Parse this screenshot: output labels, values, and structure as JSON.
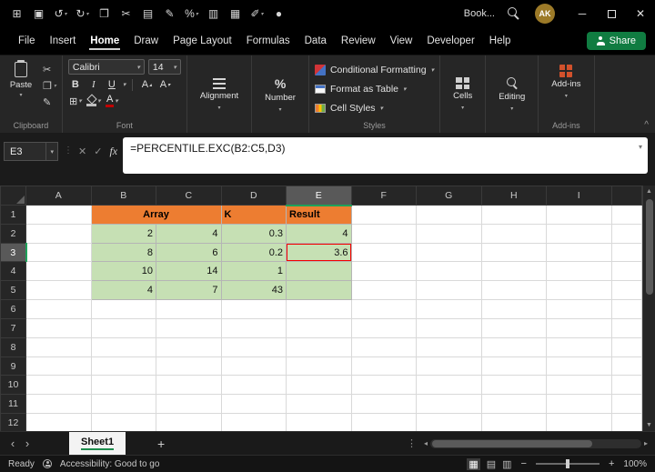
{
  "titlebar": {
    "workbook_name": "Book...",
    "avatar_initials": "AK",
    "window": {
      "minimize": "─",
      "close": "✕"
    },
    "qat": [
      {
        "name": "app-grid-icon",
        "glyph": "⊞"
      },
      {
        "name": "save-icon",
        "glyph": "▣"
      },
      {
        "name": "undo-icon",
        "glyph": "↺",
        "caret": true
      },
      {
        "name": "redo-icon",
        "glyph": "↻",
        "caret": true
      },
      {
        "name": "copy-icon",
        "glyph": "❐"
      },
      {
        "name": "cut-icon",
        "glyph": "✂"
      },
      {
        "name": "chart-icon",
        "glyph": "▤"
      },
      {
        "name": "format-painter-icon",
        "glyph": "✎"
      },
      {
        "name": "percent-style-icon",
        "glyph": "%",
        "caret": true
      },
      {
        "name": "printer-icon",
        "glyph": "▥"
      },
      {
        "name": "table-icon",
        "glyph": "▦"
      },
      {
        "name": "draw-pen-icon",
        "glyph": "✐",
        "caret": true
      },
      {
        "name": "record-icon",
        "glyph": "●"
      }
    ]
  },
  "menu": {
    "items": [
      {
        "label": "File"
      },
      {
        "label": "Insert"
      },
      {
        "label": "Home",
        "active": true
      },
      {
        "label": "Draw"
      },
      {
        "label": "Page Layout"
      },
      {
        "label": "Formulas"
      },
      {
        "label": "Data"
      },
      {
        "label": "Review"
      },
      {
        "label": "View"
      },
      {
        "label": "Developer"
      },
      {
        "label": "Help"
      }
    ],
    "share_label": "Share"
  },
  "ribbon": {
    "clipboard": {
      "paste_label": "Paste",
      "group_label": "Clipboard"
    },
    "font": {
      "font_name": "Calibri",
      "font_size": "14",
      "group_label": "Font"
    },
    "alignment": {
      "label": "Alignment"
    },
    "number": {
      "label": "Number"
    },
    "styles": {
      "buttons": [
        {
          "label": "Conditional Formatting",
          "name": "conditional-formatting-button",
          "icon": "conditional-formatting-icon"
        },
        {
          "label": "Format as Table",
          "name": "format-as-table-button",
          "icon": "format-as-table-icon"
        },
        {
          "label": "Cell Styles",
          "name": "cell-styles-button",
          "icon": "cell-styles-icon"
        }
      ],
      "group_label": "Styles"
    },
    "cells": {
      "label": "Cells"
    },
    "editing": {
      "label": "Editing"
    },
    "addins": {
      "button_label": "Add-ins",
      "group_label": "Add-ins"
    }
  },
  "formula_bar": {
    "name_box": "E3",
    "formula": "=PERCENTILE.EXC(B2:C5,D3)"
  },
  "grid": {
    "column_headers": [
      "A",
      "B",
      "C",
      "D",
      "E",
      "F",
      "G",
      "H",
      "I"
    ],
    "row_count": 12,
    "active_column": "E",
    "active_row": 3,
    "colors": {
      "table_header_fill": "#ED7D31",
      "table_data_fill": "#C6E0B4",
      "highlight_border": "#FF0000",
      "header_accent": "#1EA25A"
    },
    "cells": {
      "B1": {
        "text": "Array",
        "kind": "header",
        "colspan": 2,
        "align": "center"
      },
      "C1": {
        "skip": true
      },
      "D1": {
        "text": "K",
        "kind": "header",
        "align": "left"
      },
      "E1": {
        "text": "Result",
        "kind": "header",
        "align": "left"
      },
      "B2": {
        "text": "2",
        "kind": "data"
      },
      "C2": {
        "text": "4",
        "kind": "data"
      },
      "D2": {
        "text": "0.3",
        "kind": "data"
      },
      "E2": {
        "text": "4",
        "kind": "data"
      },
      "B3": {
        "text": "8",
        "kind": "data"
      },
      "C3": {
        "text": "6",
        "kind": "data"
      },
      "D3": {
        "text": "0.2",
        "kind": "data"
      },
      "E3": {
        "text": "3.6",
        "kind": "data",
        "highlighted": true
      },
      "B4": {
        "text": "10",
        "kind": "data"
      },
      "C4": {
        "text": "14",
        "kind": "data"
      },
      "D4": {
        "text": "1",
        "kind": "data"
      },
      "E4": {
        "text": "",
        "kind": "data"
      },
      "B5": {
        "text": "4",
        "kind": "data"
      },
      "C5": {
        "text": "7",
        "kind": "data"
      },
      "D5": {
        "text": "43",
        "kind": "data"
      },
      "E5": {
        "text": "",
        "kind": "data"
      }
    }
  },
  "sheet_tabs": {
    "tabs": [
      {
        "label": "Sheet1",
        "active": true
      }
    ],
    "add_label": "+"
  },
  "status_bar": {
    "mode": "Ready",
    "accessibility_text": "Accessibility: Good to go",
    "zoom_level": "100%",
    "view_icons": [
      {
        "name": "normal-view-icon",
        "glyph": "▦",
        "active": true
      },
      {
        "name": "page-layout-view-icon",
        "glyph": "▤"
      },
      {
        "name": "page-break-preview-icon",
        "glyph": "▥"
      }
    ]
  }
}
